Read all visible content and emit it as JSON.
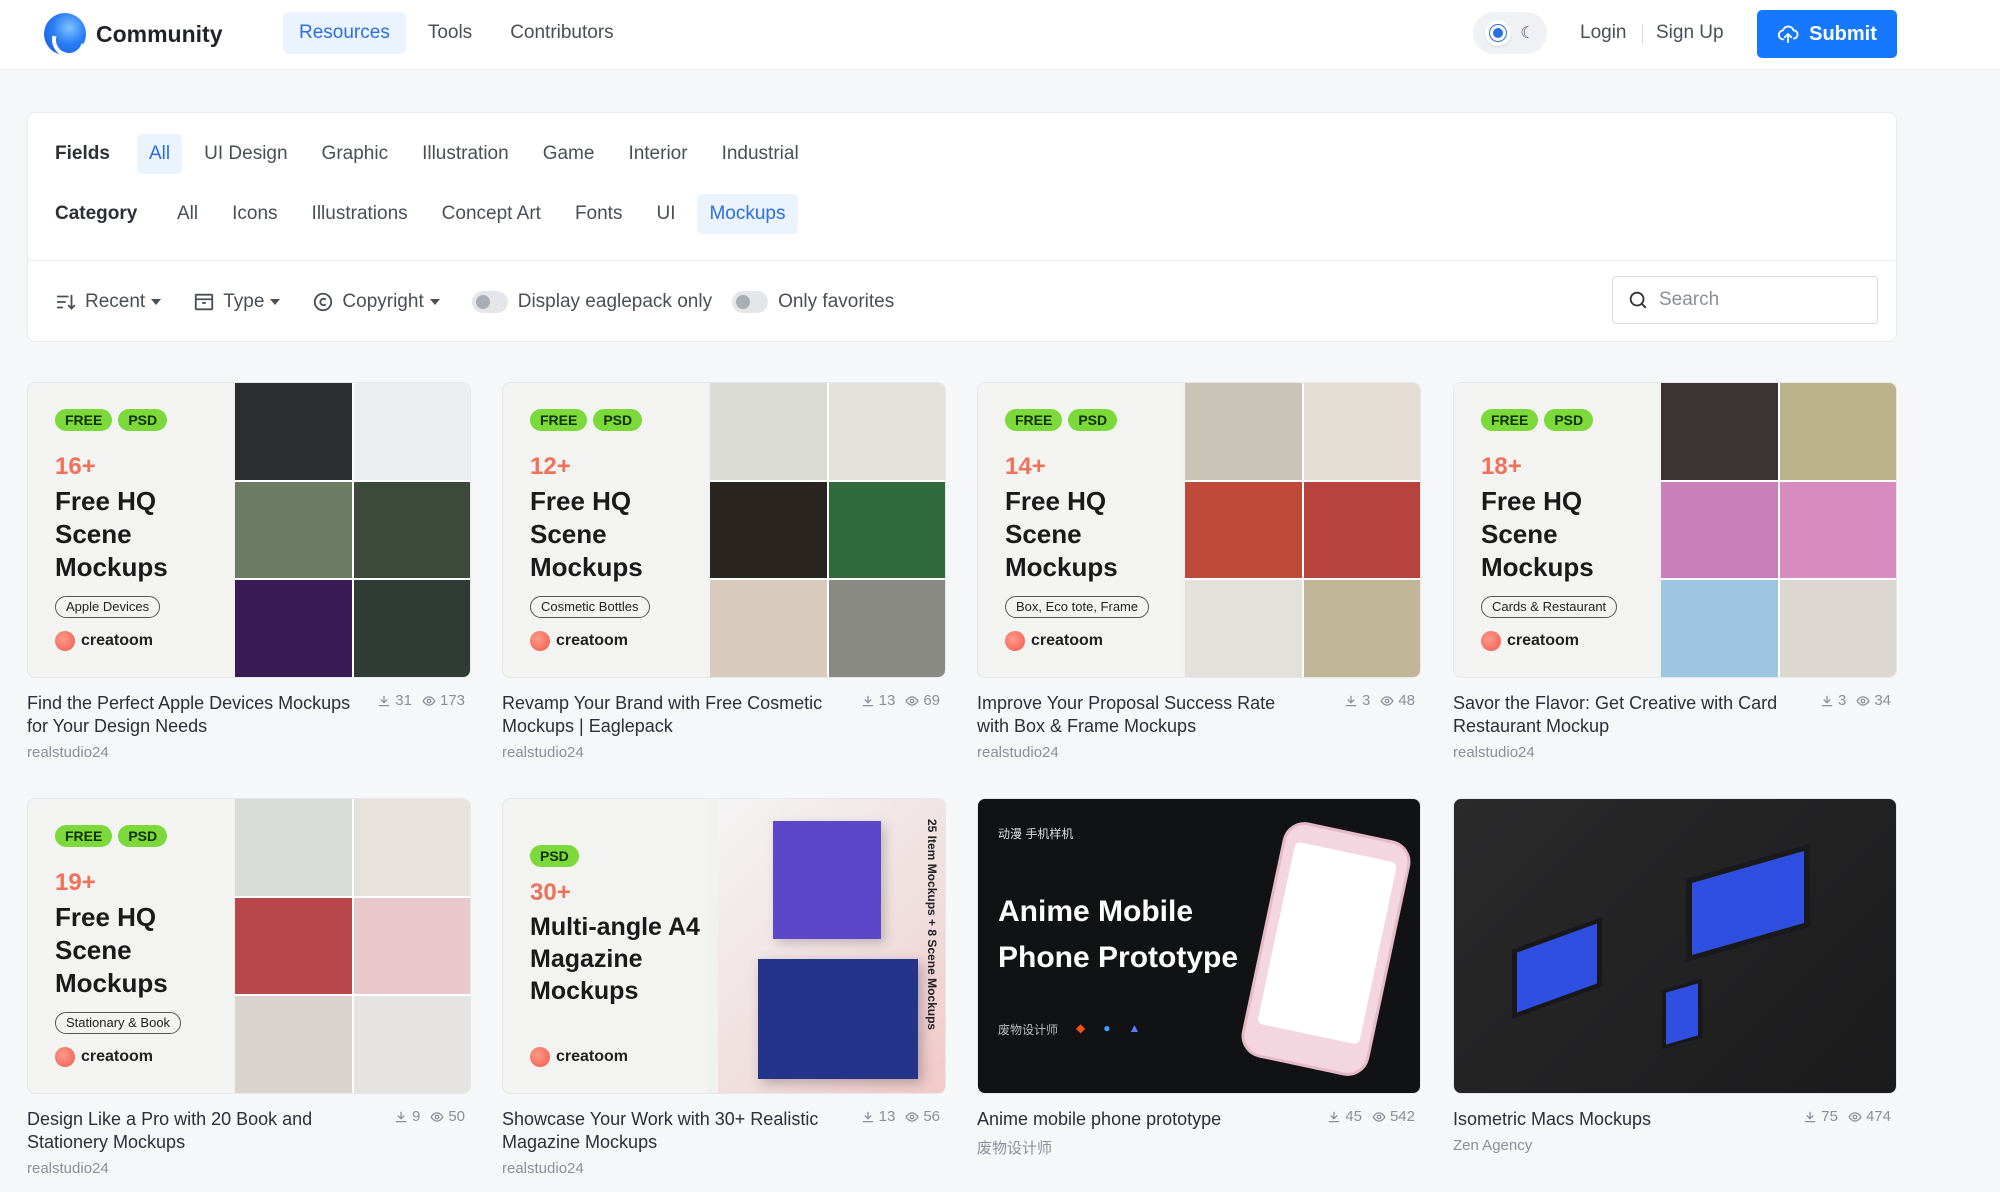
{
  "header": {
    "brand": "Community",
    "nav": [
      "Resources",
      "Tools",
      "Contributors"
    ],
    "login": "Login",
    "signup": "Sign Up",
    "submit": "Submit"
  },
  "filters": {
    "fields_label": "Fields",
    "fields": [
      "All",
      "UI Design",
      "Graphic",
      "Illustration",
      "Game",
      "Interior",
      "Industrial"
    ],
    "category_label": "Category",
    "categories": [
      "All",
      "Icons",
      "Illustrations",
      "Concept Art",
      "Fonts",
      "UI",
      "Mockups"
    ],
    "sort": "Recent",
    "type": "Type",
    "copyright": "Copyright",
    "eaglepack_toggle": "Display eaglepack only",
    "favorites_toggle": "Only favorites",
    "search_placeholder": "Search"
  },
  "cards": [
    {
      "tags": [
        "FREE",
        "PSD"
      ],
      "count": "16+",
      "headline": "Free HQ Scene Mockups",
      "pill": "Apple Devices",
      "brand": "creatoom",
      "title": "Find the Perfect Apple Devices Mockups for Your Design Needs",
      "author": "realstudio24",
      "downloads": "31",
      "views": "173",
      "tiles": [
        "#2b2d31",
        "#eceeef",
        "#6d7b63",
        "#3d4a3b",
        "#3a1b58",
        "#2f3b33"
      ]
    },
    {
      "tags": [
        "FREE",
        "PSD"
      ],
      "count": "12+",
      "headline": "Free HQ Scene Mockups",
      "pill": "Cosmetic Bottles",
      "brand": "creatoom",
      "title": "Revamp Your Brand with Free Cosmetic Mockups | Eaglepack",
      "author": "realstudio24",
      "downloads": "13",
      "views": "69",
      "tiles": [
        "#dcdcd6",
        "#e4e2dc",
        "#2a2520",
        "#2f6b3a",
        "#d8cbbd",
        "#8a8a84"
      ]
    },
    {
      "tags": [
        "FREE",
        "PSD"
      ],
      "count": "14+",
      "headline": "Free HQ Scene Mockups",
      "pill": "Box, Eco tote, Frame",
      "brand": "creatoom",
      "title": "Improve Your Proposal Success Rate with Box & Frame Mockups",
      "author": "realstudio24",
      "downloads": "3",
      "views": "48",
      "tiles": [
        "#c9c3b8",
        "#e3ddd3",
        "#bf4a3a",
        "#b8423d",
        "#e4e1dc",
        "#c2b698"
      ]
    },
    {
      "tags": [
        "FREE",
        "PSD"
      ],
      "count": "18+",
      "headline": "Free HQ Scene Mockups",
      "pill": "Cards & Restaurant",
      "brand": "creatoom",
      "title": "Savor the Flavor: Get Creative with Card Restaurant Mockup",
      "author": "realstudio24",
      "downloads": "3",
      "views": "34",
      "tiles": [
        "#3b3433",
        "#bdb38a",
        "#c97fb8",
        "#d68cc0",
        "#9dc7e0",
        "#dcd7d0"
      ]
    },
    {
      "tags": [
        "FREE",
        "PSD"
      ],
      "count": "19+",
      "headline": "Free HQ Scene Mockups",
      "pill": "Stationary & Book",
      "brand": "creatoom",
      "title": "Design Like a Pro with 20 Book and Stationery Mockups",
      "author": "realstudio24",
      "downloads": "9",
      "views": "50",
      "tiles": [
        "#d9dcd6",
        "#e7e2dc",
        "#b9464a",
        "#e9c9cc",
        "#d8d3cc",
        "#e6e4e0"
      ]
    },
    {
      "tags": [
        "PSD"
      ],
      "count": "30+",
      "headline": "Multi-angle A4 Magazine Mockups",
      "brand": "creatoom",
      "side_text": "25 Item Mockups + 8 Scene Mockups",
      "title": "Showcase Your Work with 30+ Realistic Magazine Mockups",
      "author": "realstudio24",
      "downloads": "13",
      "views": "56"
    },
    {
      "overlay_small": "动漫 手机样机",
      "overlay_title": "Anime Mobile Phone Prototype",
      "overlay_brand": "废物设计师",
      "title": "Anime mobile phone prototype",
      "author": "废物设计师",
      "downloads": "45",
      "views": "542"
    },
    {
      "title": "Isometric Macs Mockups",
      "author": "Zen Agency",
      "downloads": "75",
      "views": "474"
    }
  ]
}
